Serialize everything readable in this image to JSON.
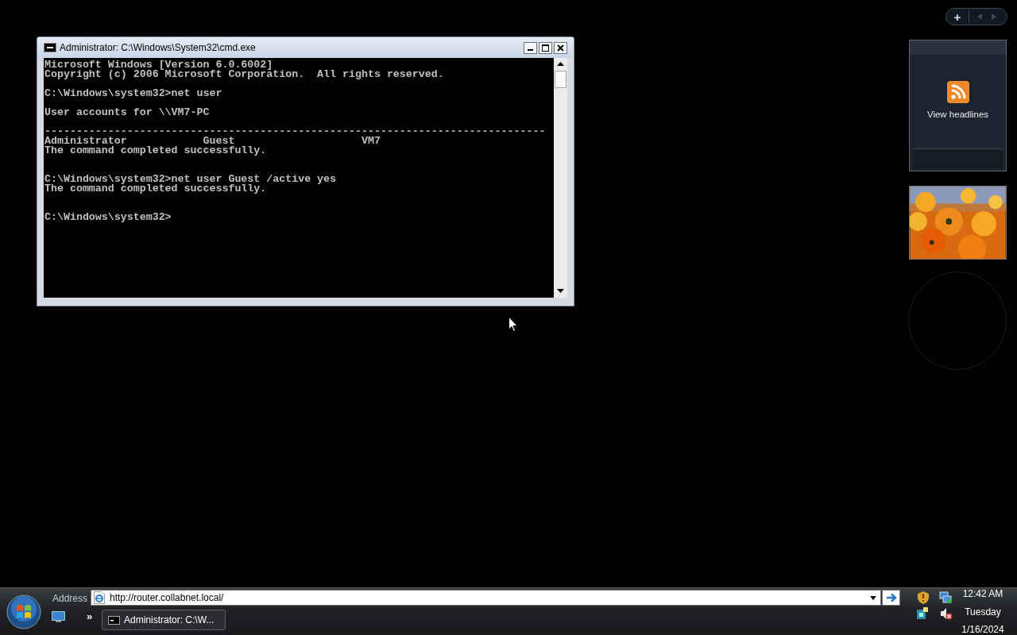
{
  "console_window": {
    "title": "Administrator: C:\\Windows\\System32\\cmd.exe",
    "buttons": [
      {
        "kind": "minimize"
      },
      {
        "kind": "maximize"
      },
      {
        "kind": "close"
      }
    ],
    "lines": [
      {
        "kind": "text",
        "text": "Microsoft Windows [Version 6.0.6002]"
      },
      {
        "kind": "text",
        "text": "Copyright (c) 2006 Microsoft Corporation.  All rights reserved."
      },
      {
        "kind": "blank"
      },
      {
        "kind": "text",
        "text": "C:\\Windows\\system32>net user"
      },
      {
        "kind": "blank"
      },
      {
        "kind": "text",
        "text": "User accounts for \\\\VM7-PC"
      },
      {
        "kind": "blank"
      },
      {
        "kind": "text",
        "text": "-------------------------------------------------------------------------------"
      },
      {
        "kind": "text",
        "text": "Administrator            Guest                    VM7"
      },
      {
        "kind": "text",
        "text": "The command completed successfully."
      },
      {
        "kind": "blank"
      },
      {
        "kind": "blank"
      },
      {
        "kind": "text",
        "text": "C:\\Windows\\system32>net user Guest /active yes"
      },
      {
        "kind": "text",
        "text": "The command completed successfully."
      },
      {
        "kind": "blank"
      },
      {
        "kind": "blank"
      },
      {
        "kind": "text",
        "text": "C:\\Windows\\system32>"
      }
    ]
  },
  "sidebar": {
    "toolbar": {
      "add": "+"
    },
    "feed_gadget": {
      "label": "View headlines"
    }
  },
  "taskbar": {
    "address_label": "Address",
    "address_value": "http://router.collabnet.local/",
    "chevron": "»",
    "tasks": [
      {
        "label": "Administrator: C:\\W...",
        "selected": false
      }
    ],
    "clock": {
      "time": "12:42 AM",
      "day": "Tuesday",
      "date": "1/16/2024"
    }
  }
}
